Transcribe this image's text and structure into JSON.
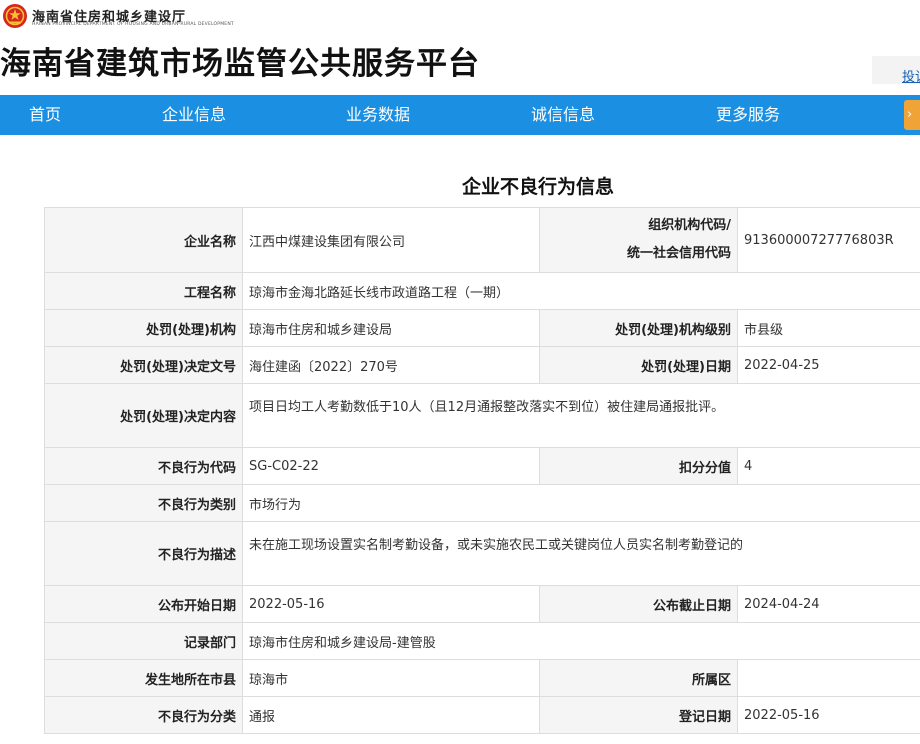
{
  "header": {
    "dept_name_cn": "海南省住房和城乡建设厅",
    "dept_name_en": "HAINAN PROVINCIAL DEPARTMENT OF HOUSING AND URBAN-RURAL DEVELOPMENT",
    "emblem_icon": "national-emblem-icon",
    "site_title": "海南省建筑市场监管公共服务平台",
    "side_link": "投诉"
  },
  "nav": {
    "items": [
      {
        "label": "首页"
      },
      {
        "label": "企业信息"
      },
      {
        "label": "业务数据"
      },
      {
        "label": "诚信信息"
      },
      {
        "label": "更多服务"
      }
    ],
    "accent_color": "#1b8fe1",
    "orange_color": "#f0a437"
  },
  "page": {
    "heading": "企业不良行为信息"
  },
  "record": {
    "company_name_label": "企业名称",
    "company_name": "江西中煤建设集团有限公司",
    "org_code_label_1": "组织机构代码/",
    "org_code_label_2": "统一社会信用代码",
    "org_code": "91360000727776803R",
    "project_name_label": "工程名称",
    "project_name": "琼海市金海北路延长线市政道路工程（一期）",
    "penalty_org_label": "处罚(处理)机构",
    "penalty_org": "琼海市住房和城乡建设局",
    "penalty_level_label": "处罚(处理)机构级别",
    "penalty_level": "市县级",
    "decision_no_label": "处罚(处理)决定文号",
    "decision_no": "海住建函〔2022〕270号",
    "penalty_date_label": "处罚(处理)日期",
    "penalty_date": "2022-04-25",
    "decision_content_label": "处罚(处理)决定内容",
    "decision_content": "项目日均工人考勤数低于10人（且12月通报整改落实不到位）被住建局通报批评。",
    "behavior_code_label": "不良行为代码",
    "behavior_code": "SG-C02-22",
    "deduction_label": "扣分分值",
    "deduction": "4",
    "behavior_category_label": "不良行为类别",
    "behavior_category": "市场行为",
    "behavior_desc_label": "不良行为描述",
    "behavior_desc": "未在施工现场设置实名制考勤设备，或未实施农民工或关键岗位人员实名制考勤登记的",
    "publish_start_label": "公布开始日期",
    "publish_start": "2022-05-16",
    "publish_end_label": "公布截止日期",
    "publish_end": "2024-04-24",
    "record_dept_label": "记录部门",
    "record_dept": "琼海市住房和城乡建设局-建管股",
    "city_label": "发生地所在市县",
    "city": "琼海市",
    "district_label": "所属区",
    "district": "",
    "classification_label": "不良行为分类",
    "classification": "通报",
    "register_date_label": "登记日期",
    "register_date": "2022-05-16"
  }
}
